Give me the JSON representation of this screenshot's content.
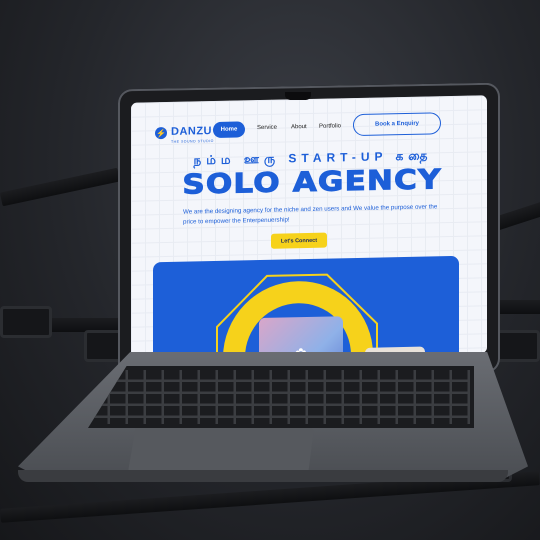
{
  "logo": {
    "name": "DANZU",
    "sub": "THE SOUND STUDIO",
    "mark": "⚡"
  },
  "nav": {
    "home": "Home",
    "service": "Service",
    "about": "About",
    "portfolio": "Portfolio",
    "enquiry": "Book a Enquiry"
  },
  "hero": {
    "tamil_line": "நம்ம ஊரு START-UP கதை",
    "headline": "SOLO AGENCY",
    "description": "We are the designing agency for the niche and zen users and We value the purpose over the price to empower the Enterpenuership!",
    "cta": "Let's Connect"
  },
  "icons": {
    "flower": "lotus-icon"
  },
  "colors": {
    "accent": "#1d5fd8",
    "yellow": "#f6d21b"
  }
}
